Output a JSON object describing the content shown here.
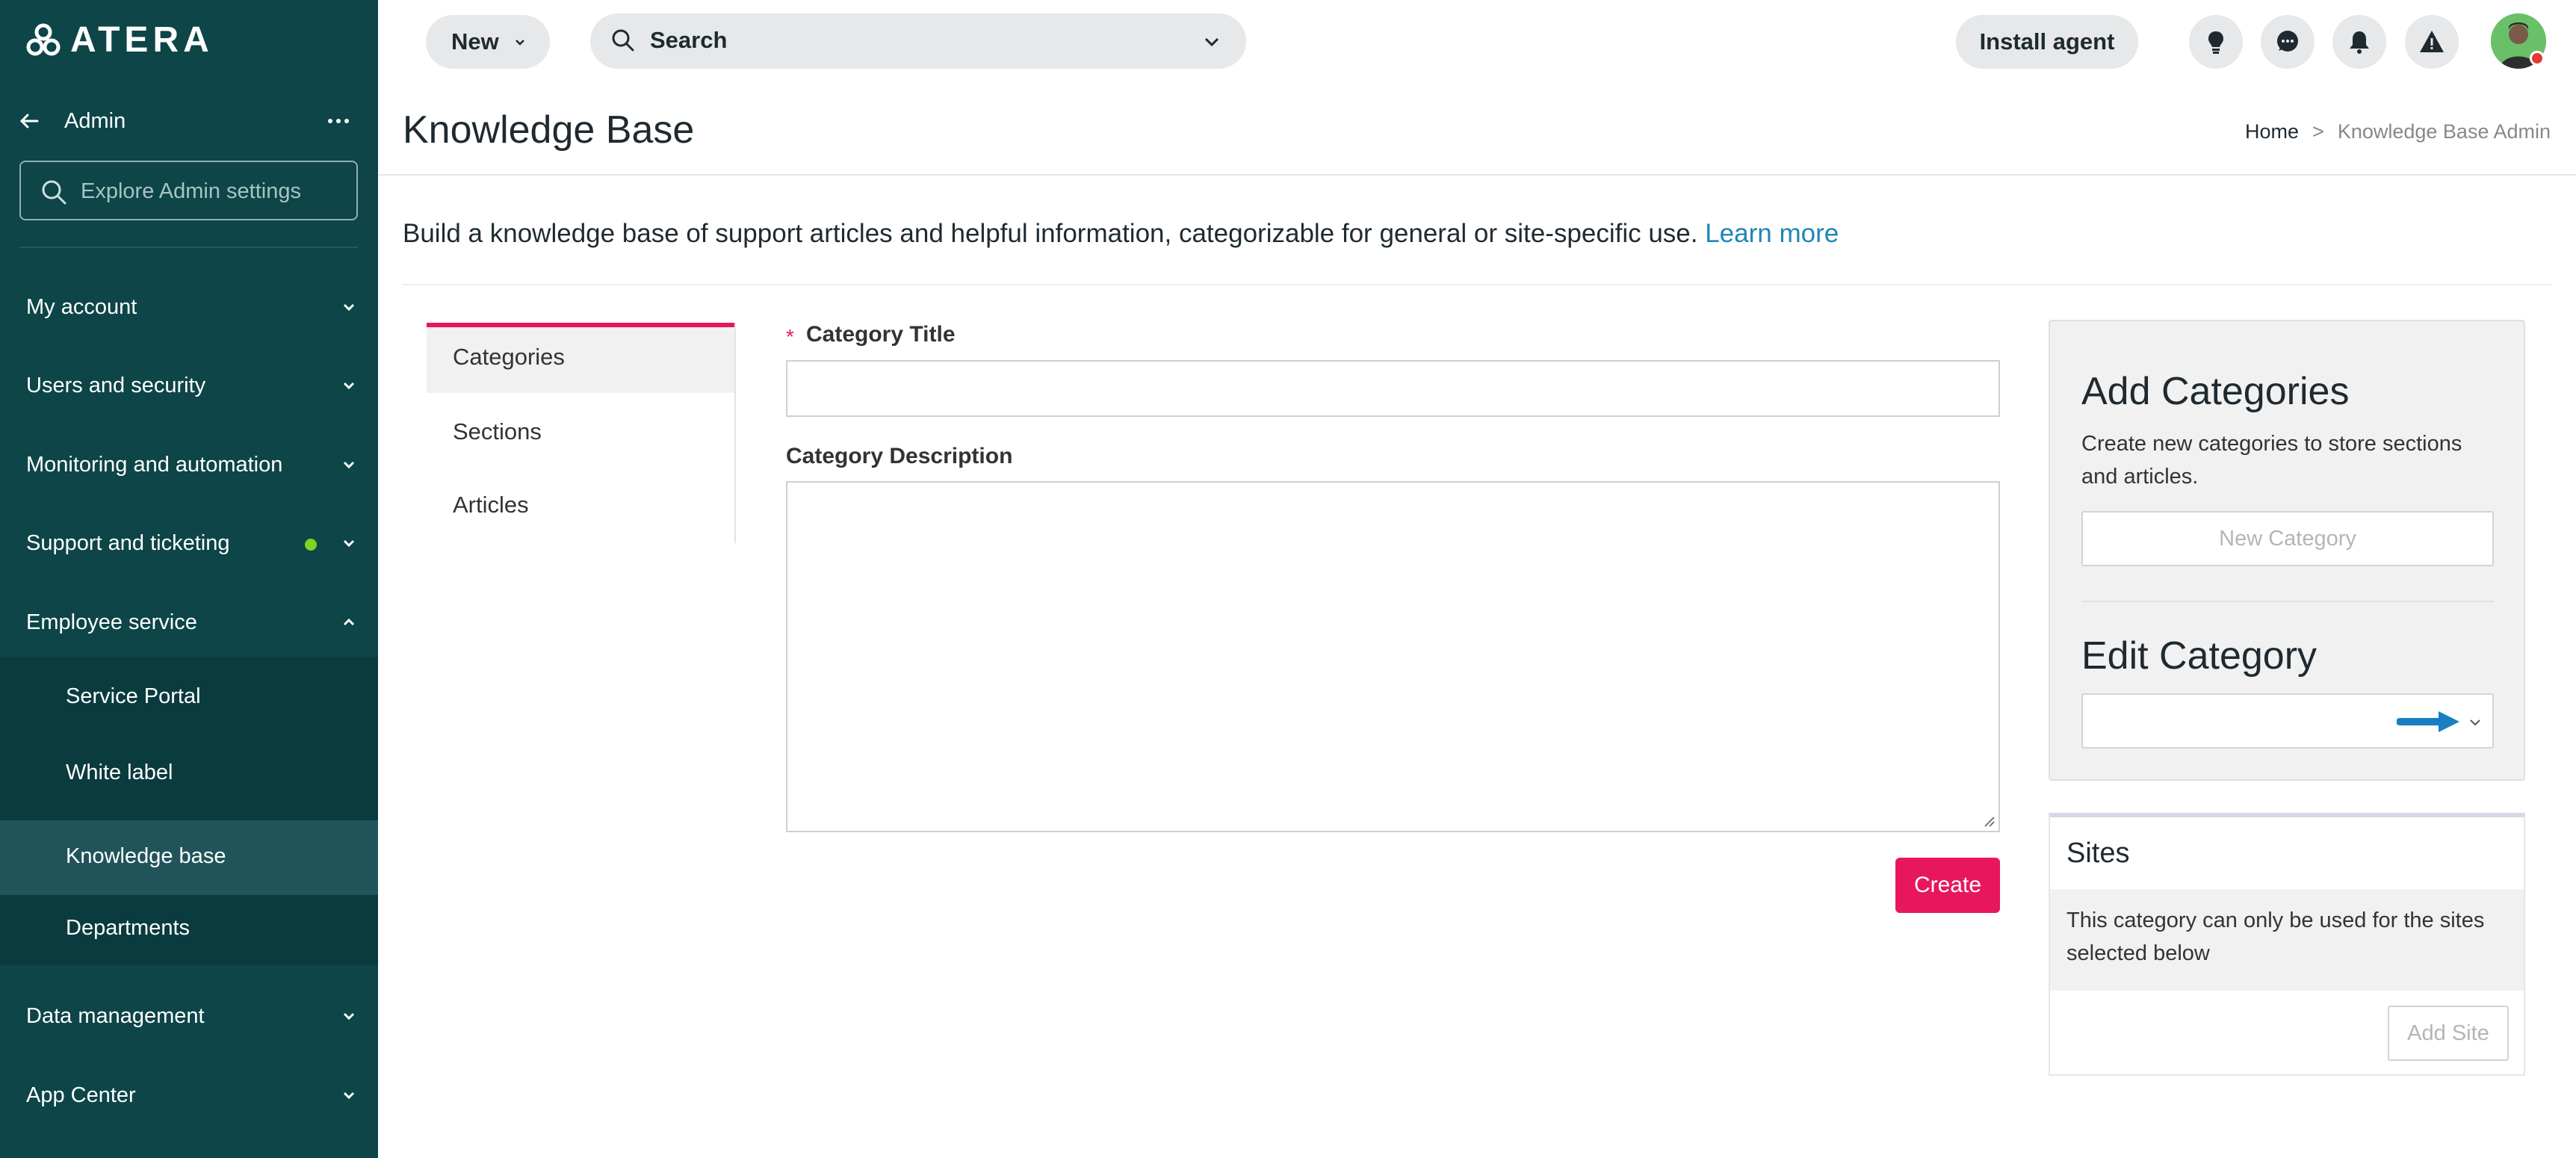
{
  "app": {
    "logo_text": "ATERA"
  },
  "sidebar": {
    "header_label": "Admin",
    "explore_placeholder": "Explore Admin settings",
    "items": [
      {
        "label": "My account"
      },
      {
        "label": "Users and security"
      },
      {
        "label": "Monitoring and automation"
      },
      {
        "label": "Support and ticketing",
        "status_dot_color": "#7ed321"
      },
      {
        "label": "Employee service",
        "expanded": true
      },
      {
        "label": "Data management"
      },
      {
        "label": "App Center"
      }
    ],
    "sub_items": [
      {
        "label": "Service Portal"
      },
      {
        "label": "White label"
      },
      {
        "label": "Knowledge base",
        "active": true
      },
      {
        "label": "Departments"
      }
    ]
  },
  "topbar": {
    "new_label": "New",
    "search_label": "Search",
    "install_label": "Install agent",
    "icons": [
      "lightbulb-icon",
      "chat-icon",
      "bell-icon",
      "warning-icon"
    ]
  },
  "page": {
    "title": "Knowledge Base",
    "breadcrumb": {
      "home": "Home",
      "separator": ">",
      "current": "Knowledge Base Admin"
    },
    "intro": "Build a knowledge base of support articles and helpful information, categorizable for general or site-specific use.",
    "learn_more": "Learn more"
  },
  "tabs": [
    {
      "label": "Categories",
      "active": true
    },
    {
      "label": "Sections"
    },
    {
      "label": "Articles"
    }
  ],
  "form": {
    "required_marker": "*",
    "title_label": "Category Title",
    "title_value": "",
    "description_label": "Category Description",
    "description_value": "",
    "create_label": "Create"
  },
  "panel": {
    "add_title": "Add Categories",
    "add_desc": "Create new categories to store sections and articles.",
    "new_category_label": "New Category",
    "edit_title": "Edit Category",
    "edit_selected": ""
  },
  "sites": {
    "title": "Sites",
    "note": "This category can only be used for the sites selected below",
    "add_site_label": "Add Site"
  },
  "colors": {
    "sidebar_bg": "#0d4548",
    "accent_pink": "#e8175d",
    "link_blue": "#1f86b4",
    "status_green": "#7ed321"
  }
}
